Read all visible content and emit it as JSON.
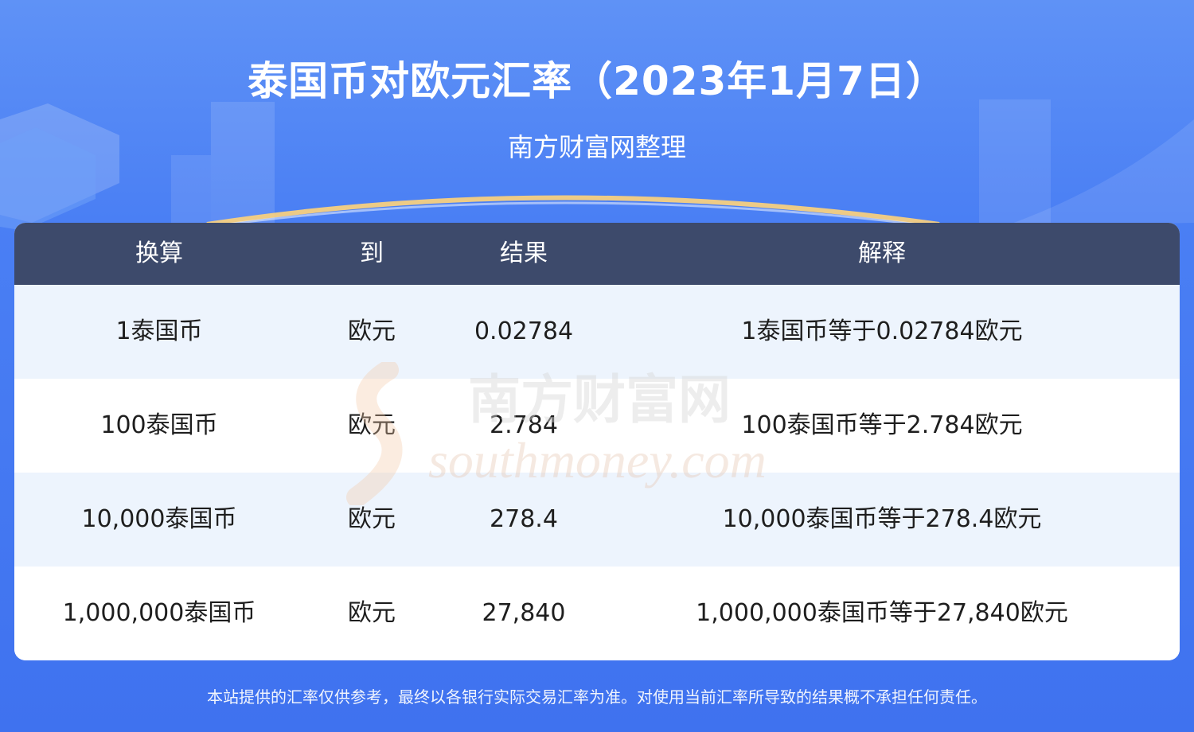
{
  "header": {
    "title": "泰国币对欧元汇率（2023年1月7日）",
    "subtitle": "南方财富网整理"
  },
  "table": {
    "columns": [
      "换算",
      "到",
      "结果",
      "解释"
    ],
    "rows": [
      {
        "amount": "1泰国币",
        "to": "欧元",
        "result": "0.02784",
        "explain": "1泰国币等于0.02784欧元"
      },
      {
        "amount": "100泰国币",
        "to": "欧元",
        "result": "2.784",
        "explain": "100泰国币等于2.784欧元"
      },
      {
        "amount": "10,000泰国币",
        "to": "欧元",
        "result": "278.4",
        "explain": "10,000泰国币等于278.4欧元"
      },
      {
        "amount": "1,000,000泰国币",
        "to": "欧元",
        "result": "27,840",
        "explain": "1,000,000泰国币等于27,840欧元"
      }
    ]
  },
  "watermark": {
    "brand_cn": "南方财富网",
    "brand_en": "southmoney.com"
  },
  "footer": {
    "disclaimer": "本站提供的汇率仅供参考，最终以各银行实际交易汇率为准。对使用当前汇率所导致的结果概不承担任何责任。"
  },
  "colors": {
    "background": "#4a7ff4",
    "table_header": "#3d4a6b",
    "row_shade": "#edf4fd"
  }
}
